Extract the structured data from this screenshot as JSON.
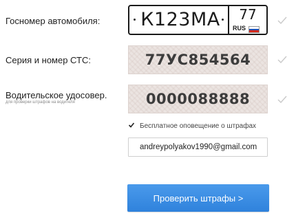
{
  "form": {
    "plate_label": "Госномер автомобиля:",
    "sts_label": "Серия и номер СТС:",
    "license_label": "Водительское удосовер.",
    "license_sublabel": "для проверки штрафов на водителя"
  },
  "plate": {
    "number": "К123МА",
    "region": "77",
    "country": "RUS",
    "flag_colors": [
      "#ffffff",
      "#1f4fb4",
      "#d52b1e"
    ]
  },
  "sts": {
    "value": "77УС854564"
  },
  "license": {
    "value": "0000088888"
  },
  "notify": {
    "label": "Бесплатное оповещение о штрафах",
    "checked": true
  },
  "email": {
    "value": "andreypolyakov1990@gmail.com"
  },
  "submit": {
    "label": "Проверить штрафы >"
  },
  "colors": {
    "accent": "#3a8de3",
    "check_gray": "#c9c9c9"
  }
}
